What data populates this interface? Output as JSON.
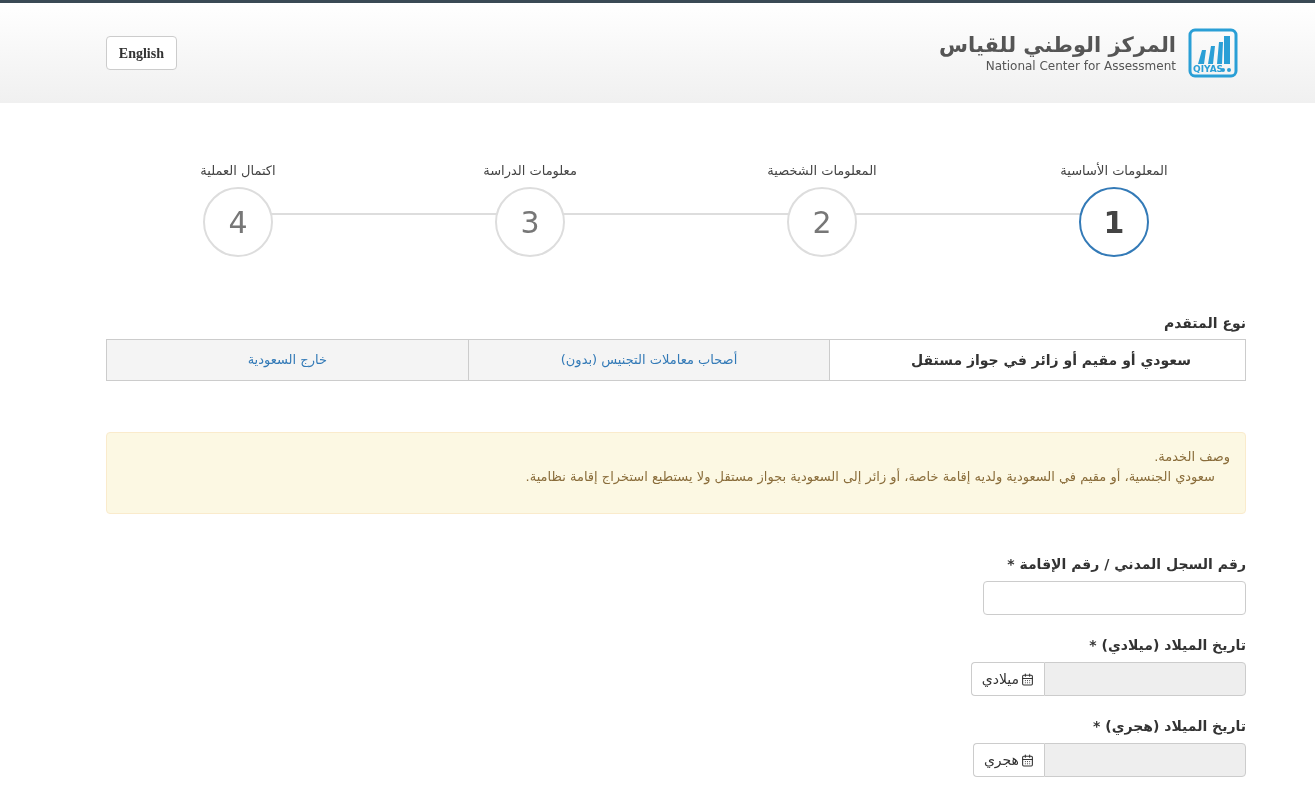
{
  "header": {
    "language_button": "English",
    "logo": {
      "arabic": "المركز الوطني للقياس",
      "english": "National Center for Assessment",
      "badge": "QIYAS"
    }
  },
  "steps": [
    {
      "label": "المعلومات الأساسية",
      "number": "1",
      "selected": true
    },
    {
      "label": "المعلومات الشخصية",
      "number": "2",
      "selected": false
    },
    {
      "label": "معلومات الدراسة",
      "number": "3",
      "selected": false
    },
    {
      "label": "اكتمال العملية",
      "number": "4",
      "selected": false
    }
  ],
  "applicant_type": {
    "label": "نوع المتقدم",
    "tabs": [
      {
        "label": "سعودي أو مقيم أو زائر في جواز مستقل",
        "selected": true
      },
      {
        "label": "أصحاب معاملات التجنيس (بدون)",
        "selected": false
      },
      {
        "label": "خارج السعودية",
        "selected": false
      }
    ]
  },
  "service_description": {
    "title": "وصف الخدمة.",
    "text": "سعودي الجنسية، أو مقيم في السعودية ولديه إقامة خاصة، أو زائر إلى السعودية بجواز مستقل ولا يستطيع استخراج إقامة نظامية."
  },
  "fields": [
    {
      "kind": "text",
      "label": "رقم السجل المدني / رقم الإقامة *"
    },
    {
      "kind": "date",
      "label": "تاريخ الميلاد (ميلادي) *",
      "button": "ميلادي"
    },
    {
      "kind": "date",
      "label": "تاريخ الميلاد (هجري) *",
      "button": "هجري"
    }
  ]
}
